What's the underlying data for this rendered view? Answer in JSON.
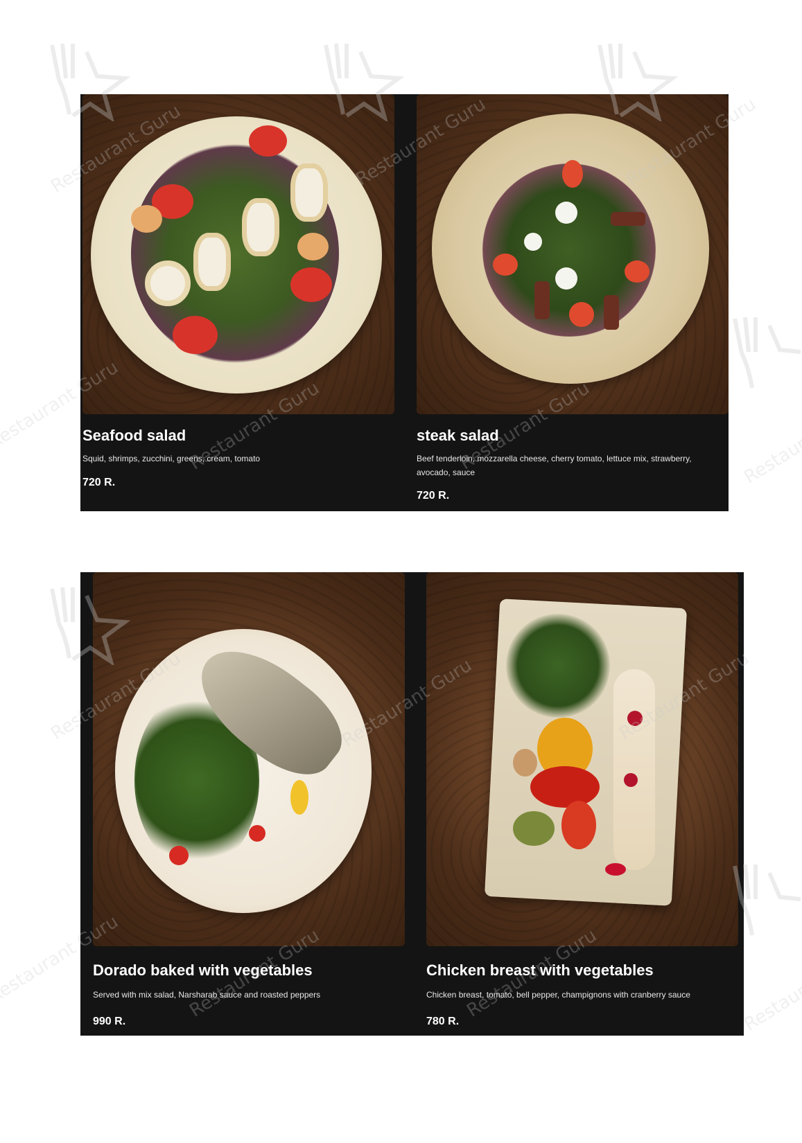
{
  "colors": {
    "panel_bg": "#141414",
    "text": "#ffffff",
    "wood": "#6b4327"
  },
  "watermark_text": "Restaurant Guru",
  "watermark_icon": "fork-star-icon",
  "dishes": [
    {
      "title": "Seafood salad",
      "description": "Squid, shrimps, zucchini, greens, cream, tomato",
      "price": "720",
      "currency": "R.",
      "photo_icon": "seafood-salad-photo"
    },
    {
      "title": "steak salad",
      "description": "Beef tenderloin, mozzarella cheese, cherry tomato, lettuce mix, strawberry, avocado, sauce",
      "price": "720",
      "currency": "R.",
      "photo_icon": "steak-salad-photo"
    },
    {
      "title": "Dorado baked with vegetables",
      "description": "Served with mix salad, Narsharab sauce and roasted peppers",
      "price": "990",
      "currency": "R.",
      "photo_icon": "dorado-photo"
    },
    {
      "title": "Chicken breast with vegetables",
      "description": "Chicken breast, tomato, bell pepper, champignons with cranberry sauce",
      "price": "780",
      "currency": "R.",
      "photo_icon": "chicken-breast-photo"
    }
  ]
}
